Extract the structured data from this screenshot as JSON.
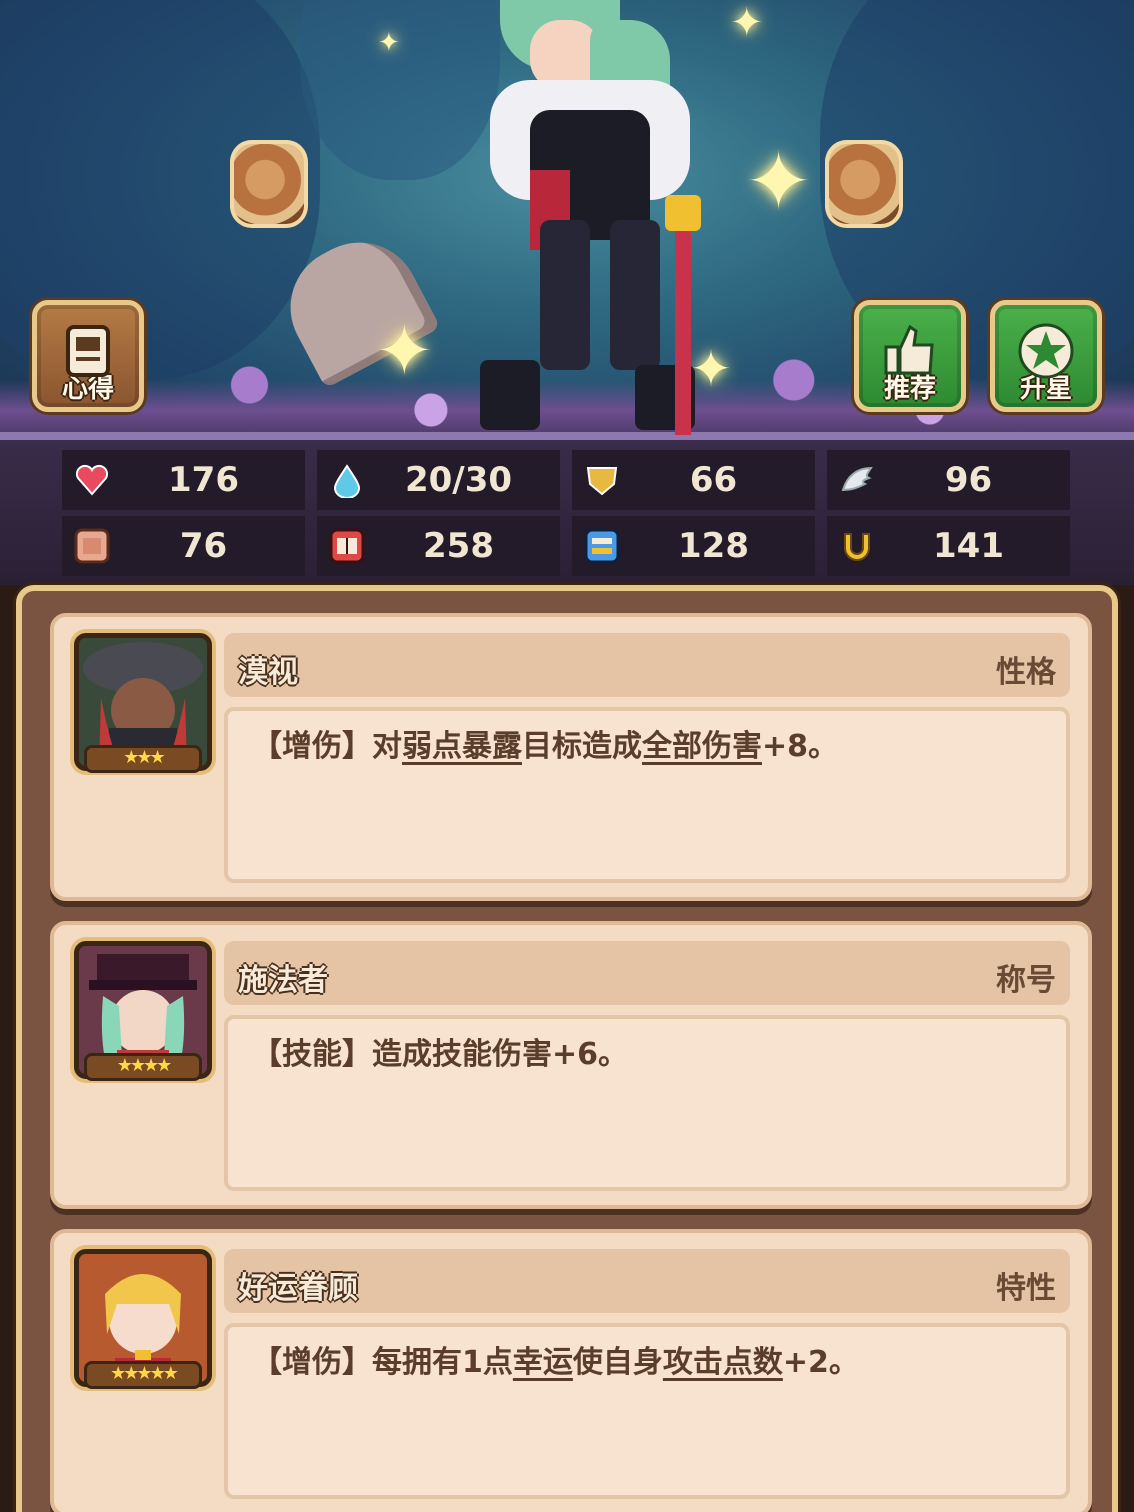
{
  "buttons": {
    "xinde": "心得",
    "tuijian": "推荐",
    "shengxing": "升星"
  },
  "stats": [
    {
      "icon": "heart-icon",
      "value": "176",
      "color": "#e84a5f"
    },
    {
      "icon": "water-drop-icon",
      "value": "20/30",
      "color": "#5fc9e8"
    },
    {
      "icon": "shield-icon",
      "value": "66",
      "color": "#e8b840"
    },
    {
      "icon": "wing-icon",
      "value": "96",
      "color": "#e8e8f0"
    },
    {
      "icon": "fist-icon",
      "value": "76",
      "color": "#e8a890"
    },
    {
      "icon": "spellbook-icon",
      "value": "258",
      "color": "#e04848"
    },
    {
      "icon": "scroll-icon",
      "value": "128",
      "color": "#4a9ae8"
    },
    {
      "icon": "horseshoe-icon",
      "value": "141",
      "color": "#f0c030"
    }
  ],
  "traits": [
    {
      "name": "漠视",
      "type": "性格",
      "stars": "★★★",
      "desc_parts": [
        {
          "text": "【增伤】对",
          "ul": false
        },
        {
          "text": "弱点暴露",
          "ul": true
        },
        {
          "text": "目标造成",
          "ul": false
        },
        {
          "text": "全部伤害",
          "ul": true
        },
        {
          "text": "+8。",
          "ul": false
        }
      ]
    },
    {
      "name": "施法者",
      "type": "称号",
      "stars": "★★★★",
      "desc_parts": [
        {
          "text": "【技能】造成技能伤害+6。",
          "ul": false
        }
      ]
    },
    {
      "name": "好运眷顾",
      "type": "特性",
      "stars": "★★★★★",
      "desc_parts": [
        {
          "text": "【增伤】每拥有1点",
          "ul": false
        },
        {
          "text": "幸运",
          "ul": true
        },
        {
          "text": "使自身",
          "ul": false
        },
        {
          "text": "攻击点数",
          "ul": true
        },
        {
          "text": "+2。",
          "ul": false
        }
      ]
    }
  ]
}
